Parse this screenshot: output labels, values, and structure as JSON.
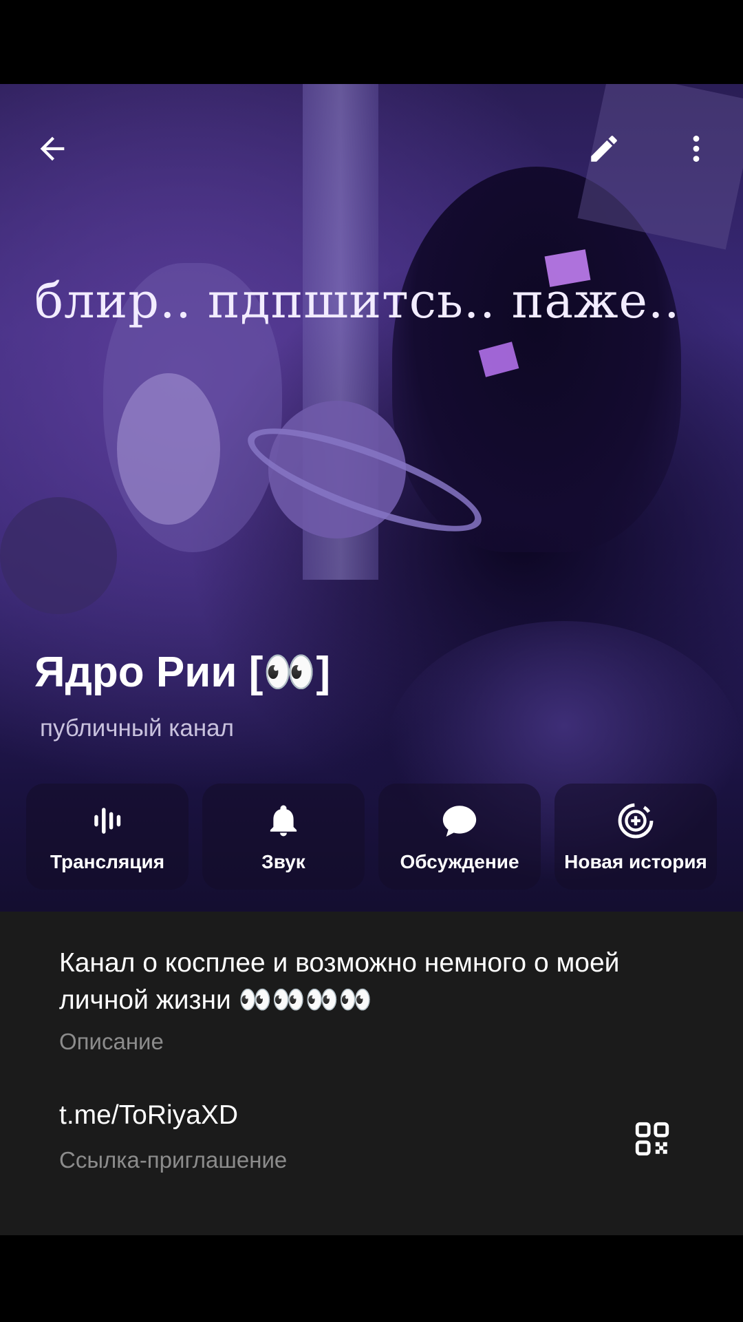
{
  "header": {
    "cover_text": "блир.. пдпшитсь.. паже..",
    "title": "Ядро Рии [👀]",
    "subtitle": "публичный канал",
    "icons": {
      "back": "arrow-left-icon",
      "edit": "pencil-icon",
      "more": "more-vertical-icon"
    }
  },
  "actions": [
    {
      "label": "Трансляция",
      "icon": "live-stream-icon"
    },
    {
      "label": "Звук",
      "icon": "bell-icon"
    },
    {
      "label": "Обсуждение",
      "icon": "chat-bubble-icon"
    },
    {
      "label": "Новая история",
      "icon": "add-story-icon"
    }
  ],
  "info": {
    "description": "Канал о косплее и возможно немного о моей личной жизни 👀👀👀👀",
    "description_label": "Описание",
    "link": "t.me/ToRiyaXD",
    "link_label": "Ссылка-приглашение",
    "qr_icon": "qr-code-icon"
  },
  "colors": {
    "info_background": "#1b1b1b",
    "secondary_text": "#8c8c8c",
    "header_accent": "#3b2a7a"
  }
}
